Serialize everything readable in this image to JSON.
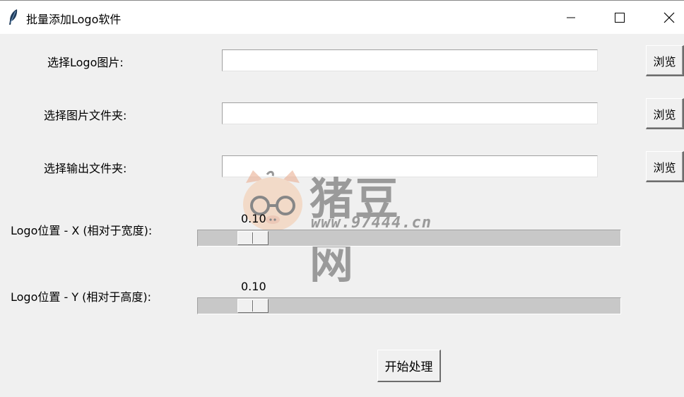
{
  "window": {
    "title": "批量添加Logo软件",
    "icon": "feather-icon"
  },
  "form": {
    "logo_label": "选择Logo图片:",
    "logo_value": "",
    "images_label": "选择图片文件夹:",
    "images_value": "",
    "output_label": "选择输出文件夹:",
    "output_value": "",
    "browse_label": "浏览"
  },
  "scales": {
    "x_label": "Logo位置 - X (相对于宽度):",
    "x_value": "0.10",
    "y_label": "Logo位置 - Y (相对于高度):",
    "y_value": "0.10"
  },
  "actions": {
    "start_label": "开始处理"
  },
  "watermark": {
    "title": "猪豆网",
    "url": "www.97444.cn"
  }
}
